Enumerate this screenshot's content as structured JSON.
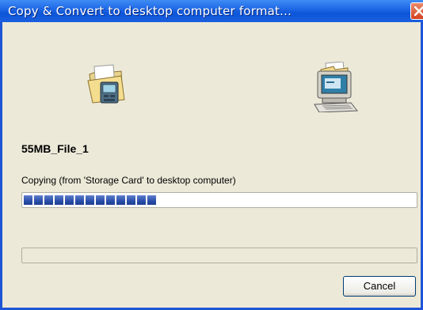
{
  "window": {
    "title": "Copy & Convert to desktop computer format..."
  },
  "icons": {
    "source": "folder-device-icon",
    "destination": "desktop-computer-icon",
    "close": "close-icon"
  },
  "file": {
    "name": "55MB_File_1"
  },
  "status": {
    "text": "Copying (from 'Storage Card' to desktop computer)"
  },
  "progress": {
    "file_progress_percent": 35,
    "overall_progress_percent": 0
  },
  "buttons": {
    "cancel_label": "Cancel"
  },
  "colors": {
    "titlebar": "#1b64e4",
    "progress_fill": "#2a4ea8",
    "window_bg": "#ece9d8"
  }
}
